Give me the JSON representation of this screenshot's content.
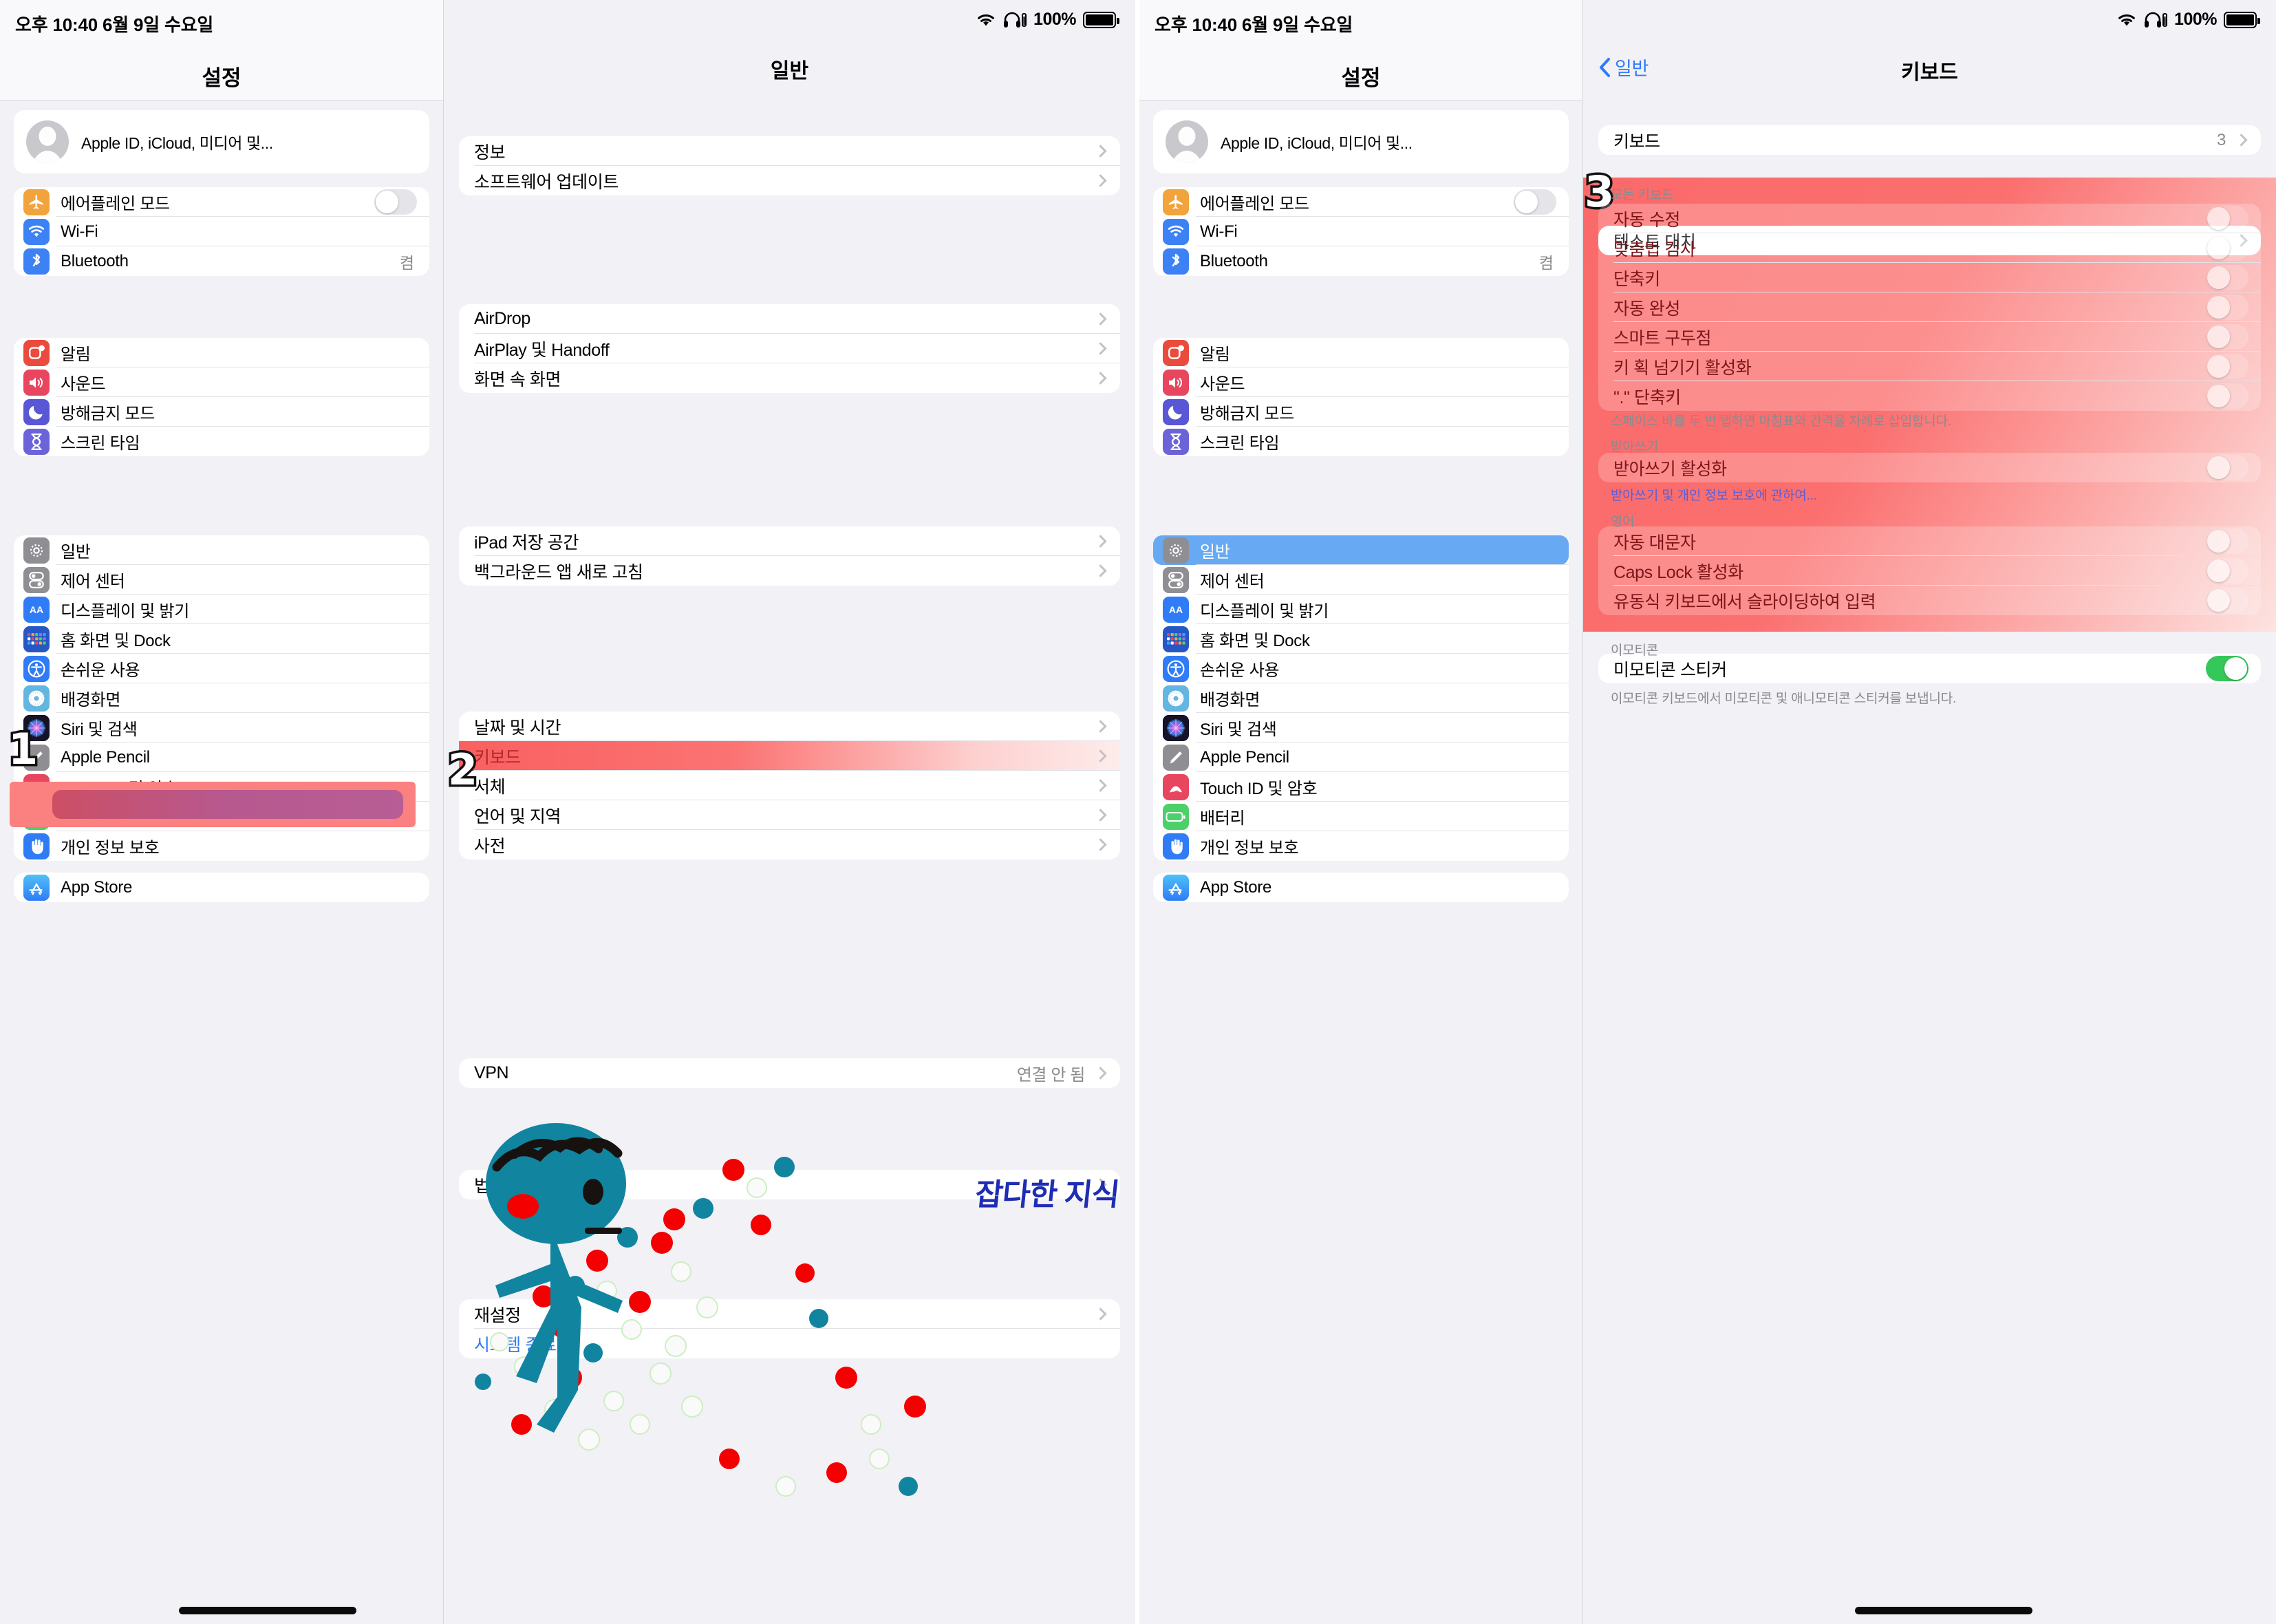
{
  "status": {
    "time": "오후 10:40   6월 9일 수요일",
    "battery_pct": "100%",
    "wifi_icon": "wifi-icon",
    "headphones_icon": "headphones-icon"
  },
  "sidebar": {
    "title": "설정",
    "account": {
      "label": "Apple ID, iCloud, 미디어 및...",
      "avatar": "person-avatar"
    },
    "groups": [
      {
        "rows": [
          {
            "icon": "airplane-icon",
            "color": "#f2a33c",
            "label": "에어플레인 모드",
            "control": "toggle",
            "on": false
          },
          {
            "icon": "wifi-icon",
            "color": "#3d82f4",
            "label": "Wi-Fi",
            "control": "none"
          },
          {
            "icon": "bluetooth-icon",
            "color": "#3d82f4",
            "label": "Bluetooth",
            "control": "value",
            "value": "켬"
          }
        ]
      },
      {
        "rows": [
          {
            "icon": "notification-icon",
            "color": "#eb4b3d",
            "label": "알림"
          },
          {
            "icon": "sound-icon",
            "color": "#e8455f",
            "label": "사운드"
          },
          {
            "icon": "moon-icon",
            "color": "#5a57d6",
            "label": "방해금지 모드"
          },
          {
            "icon": "hourglass-icon",
            "color": "#6c63d8",
            "label": "스크린 타임"
          }
        ]
      },
      {
        "rows": [
          {
            "icon": "gear-icon",
            "color": "#8e8e93",
            "label": "일반",
            "selected": true
          },
          {
            "icon": "controlcenter-icon",
            "color": "#8e8e93",
            "label": "제어 센터"
          },
          {
            "icon": "display-icon",
            "color": "#2f7cf6",
            "label": "디스플레이 및 밝기"
          },
          {
            "icon": "homescreen-icon",
            "color": "#2657c4",
            "label": "홈 화면 및 Dock"
          },
          {
            "icon": "accessibility-icon",
            "color": "#2f7cf6",
            "label": "손쉬운 사용"
          },
          {
            "icon": "wallpaper-icon",
            "color": "#63b6e0",
            "label": "배경화면"
          },
          {
            "icon": "siri-icon",
            "color": "#1b1b2b",
            "label": "Siri 및 검색"
          },
          {
            "icon": "pencil-icon",
            "color": "#8e8e93",
            "label": "Apple Pencil"
          },
          {
            "icon": "touchid-icon",
            "color": "#e8455f",
            "label": "Touch ID 및 암호"
          },
          {
            "icon": "battery-icon",
            "color": "#4cd06a",
            "label": "배터리"
          },
          {
            "icon": "privacy-icon",
            "color": "#2f7cf6",
            "label": "개인 정보 보호"
          }
        ]
      },
      {
        "rows": [
          {
            "icon": "appstore-icon",
            "color": "#3fa3f3",
            "label": "App Store"
          }
        ]
      }
    ]
  },
  "general_pane": {
    "title": "일반",
    "groups": [
      {
        "rows": [
          {
            "label": "정보"
          },
          {
            "label": "소프트웨어 업데이트"
          }
        ]
      },
      {
        "rows": [
          {
            "label": "AirDrop"
          },
          {
            "label": "AirPlay 및 Handoff"
          },
          {
            "label": "화면 속 화면"
          }
        ]
      },
      {
        "rows": [
          {
            "label": "iPad 저장 공간"
          },
          {
            "label": "백그라운드 앱 새로 고침"
          }
        ]
      },
      {
        "rows": [
          {
            "label": "날짜 및 시간"
          },
          {
            "label": "키보드",
            "highlight": true
          },
          {
            "label": "서체"
          },
          {
            "label": "언어 및 지역"
          },
          {
            "label": "사전"
          }
        ]
      },
      {
        "rows": [
          {
            "label": "VPN",
            "value": "연결 안 됨"
          }
        ]
      },
      {
        "rows": [
          {
            "label": "법률 및 규제 정보"
          }
        ]
      },
      {
        "rows": [
          {
            "label": "재설정"
          },
          {
            "label": "시스템 종료",
            "link": true
          }
        ]
      }
    ]
  },
  "keyboard_pane": {
    "back_label": "일반",
    "title": "키보드",
    "row_keyboards": {
      "label": "키보드",
      "value": "3"
    },
    "row_text_replacement": {
      "label": "텍스트 대치"
    },
    "section_all_keyboards": {
      "header": "모든 키보드",
      "rows": [
        {
          "label": "자동 수정",
          "on": false
        },
        {
          "label": "맞춤법 검사",
          "on": false
        },
        {
          "label": "단축키",
          "on": false
        },
        {
          "label": "자동 완성",
          "on": false
        },
        {
          "label": "스마트 구두점",
          "on": false
        },
        {
          "label": "키 획 넘기기 활성화",
          "on": false
        },
        {
          "label": "\".\" 단축키",
          "on": false
        }
      ],
      "footer": "스페이스 바를 두 번 탭하면 마침표와 간격을 차례로 삽입합니다."
    },
    "section_dictation": {
      "header": "받아쓰기",
      "rows": [
        {
          "label": "받아쓰기 활성화",
          "on": false
        }
      ],
      "footer_link": "받아쓰기 및 개인 정보 보호에 관하여..."
    },
    "section_english": {
      "header": "영어",
      "rows": [
        {
          "label": "자동 대문자",
          "on": false
        },
        {
          "label": "Caps Lock 활성화",
          "on": false
        },
        {
          "label": "유동식 키보드에서 슬라이딩하여 입력",
          "on": false
        }
      ]
    },
    "section_emoji": {
      "header": "이모티콘",
      "rows": [
        {
          "label": "미모티콘 스티커",
          "on": true
        }
      ],
      "footer": "이모티콘 키보드에서 미모티콘 및 애니모티콘 스티커를 보냅니다."
    }
  },
  "annotations": {
    "step1": "1",
    "step2": "2",
    "step3": "3",
    "watermark": "잡다한 지식"
  },
  "colors": {
    "highlight_red": "#fb6a6a",
    "selected_blue": "#67a9f2",
    "toggle_on_green": "#34c759",
    "link_blue": "#2f7cf6",
    "toon_teal": "#1184a0",
    "toon_red": "#f40000",
    "watermark_blue": "#1e2db4"
  }
}
